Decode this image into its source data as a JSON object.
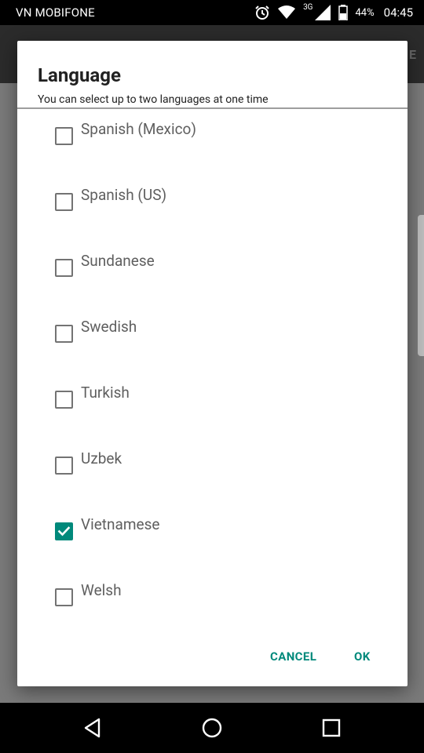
{
  "status_bar": {
    "carrier": "VN MOBIFONE",
    "network_type": "3G",
    "battery_percent": "44%",
    "time": "04:45",
    "icons": [
      "alarm-icon",
      "wifi-icon",
      "signal-icon",
      "battery-icon"
    ]
  },
  "appbar": {
    "action_partial": "E"
  },
  "dialog": {
    "title": "Language",
    "subtitle": "You can select up to two languages at one time",
    "items": [
      {
        "label": "Spanish (Mexico)",
        "checked": false
      },
      {
        "label": "Spanish (US)",
        "checked": false
      },
      {
        "label": "Sundanese",
        "checked": false
      },
      {
        "label": "Swedish",
        "checked": false
      },
      {
        "label": "Turkish",
        "checked": false
      },
      {
        "label": "Uzbek",
        "checked": false
      },
      {
        "label": "Vietnamese",
        "checked": true
      },
      {
        "label": "Welsh",
        "checked": false
      }
    ],
    "cancel_label": "CANCEL",
    "ok_label": "OK"
  },
  "colors": {
    "accent": "#00897b",
    "checkbox_border": "#737373",
    "label_text": "#5f5f5f"
  },
  "nav_bar": {
    "icons": [
      "back-icon",
      "home-icon",
      "recents-icon"
    ]
  }
}
